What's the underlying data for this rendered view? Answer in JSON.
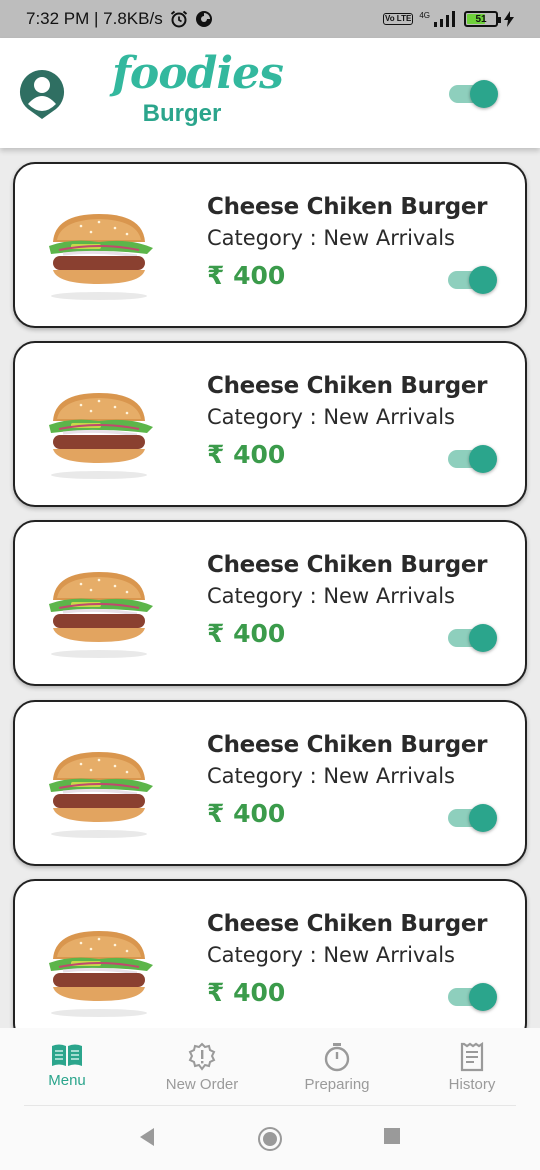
{
  "status_bar": {
    "time_speed": "7:32 PM | 7.8KB/s",
    "network_label": "4G",
    "lte_label": "Vo LTE",
    "battery": "51"
  },
  "header": {
    "logo_word": "foodies",
    "logo_subtitle": "Burger",
    "toggle_on": true
  },
  "menu_items": [
    {
      "name": "Cheese Chiken Burger",
      "category": "Category : New Arrivals",
      "price": "₹ 400",
      "available": true
    },
    {
      "name": "Cheese Chiken Burger",
      "category": "Category : New Arrivals",
      "price": "₹ 400",
      "available": true
    },
    {
      "name": "Cheese Chiken Burger",
      "category": "Category : New Arrivals",
      "price": "₹ 400",
      "available": true
    },
    {
      "name": "Cheese Chiken Burger",
      "category": "Category : New Arrivals",
      "price": "₹ 400",
      "available": true
    },
    {
      "name": "Cheese Chiken Burger",
      "category": "Category : New Arrivals",
      "price": "₹ 400",
      "available": true
    }
  ],
  "bottom_nav": {
    "items": [
      {
        "label": "Menu",
        "icon": "menu-book-icon",
        "active": true
      },
      {
        "label": "New Order",
        "icon": "new-order-badge-icon",
        "active": false
      },
      {
        "label": "Preparing",
        "icon": "timer-icon",
        "active": false
      },
      {
        "label": "History",
        "icon": "receipt-icon",
        "active": false
      }
    ]
  },
  "colors": {
    "brand": "#2ba58c",
    "price": "#3b9b4b",
    "toggle_track": "#8ecfbd"
  }
}
